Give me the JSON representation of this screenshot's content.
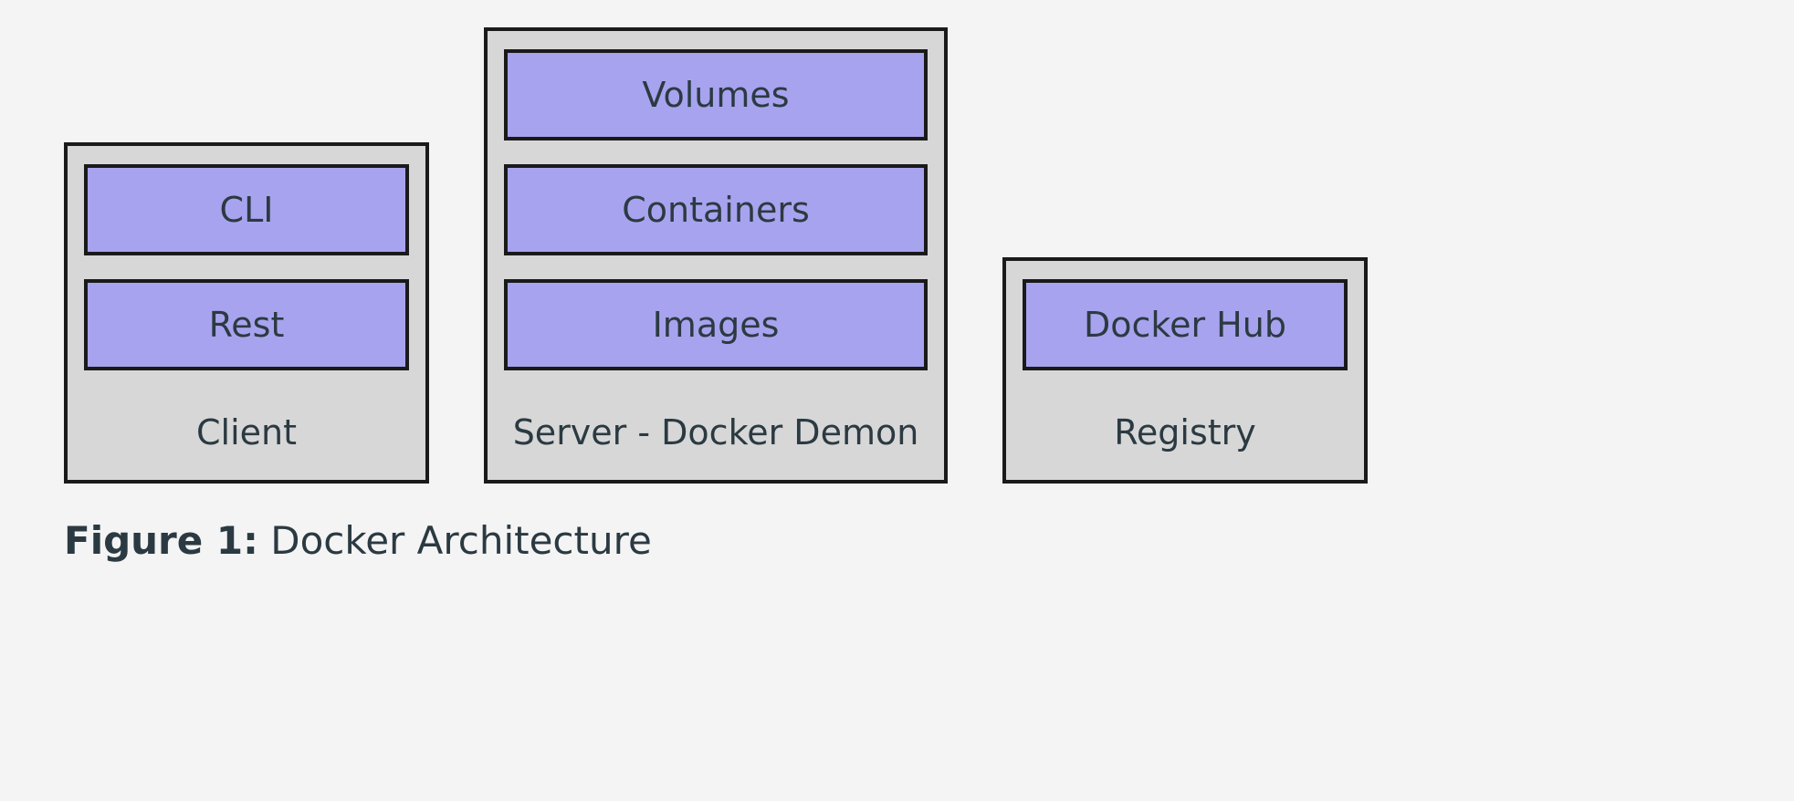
{
  "diagram": {
    "groups": [
      {
        "id": "client",
        "title": "Client",
        "blocks": [
          "CLI",
          "Rest"
        ]
      },
      {
        "id": "server",
        "title": "Server - Docker Demon",
        "blocks": [
          "Volumes",
          "Containers",
          "Images"
        ]
      },
      {
        "id": "registry",
        "title": "Registry",
        "blocks": [
          "Docker Hub"
        ]
      }
    ]
  },
  "caption": {
    "label": "Figure 1:",
    "text": " Docker Architecture"
  },
  "colors": {
    "page_bg": "#f4f4f4",
    "group_bg": "#d7d7d7",
    "block_bg": "#a8a3ee",
    "border": "#1a1a1a",
    "text": "#2b3a42"
  }
}
